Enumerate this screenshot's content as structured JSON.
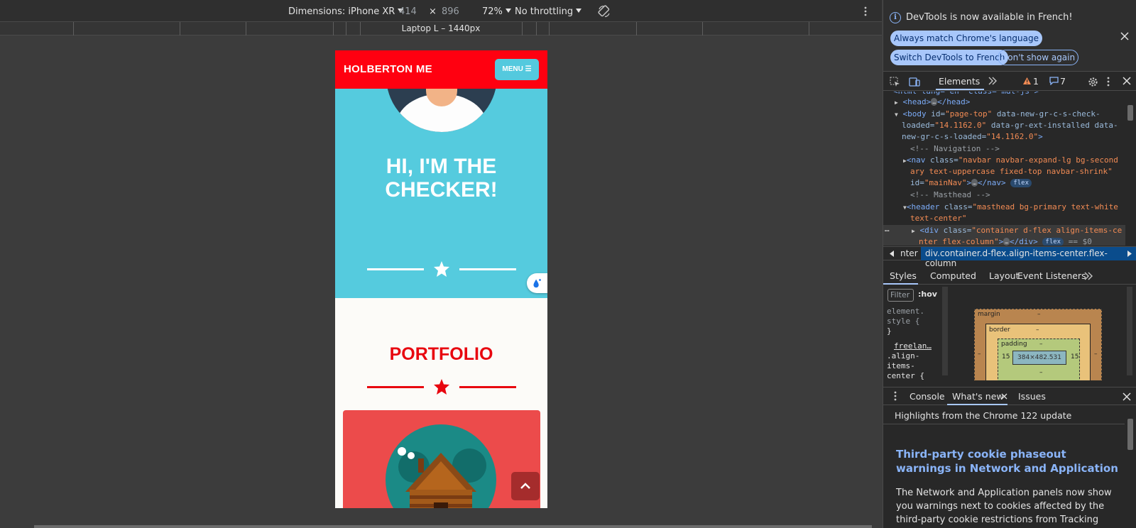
{
  "emulation": {
    "device_label": "Dimensions: iPhone XR",
    "width": "414",
    "times": "×",
    "height": "896",
    "zoom": "72%",
    "throttling": "No throttling",
    "media_query_label": "Laptop L – 1440px"
  },
  "page": {
    "brand": "HOLBERTON ME",
    "menu_label": "MENU ☰",
    "heading": "HI, I'M THE CHECKER!",
    "portfolio_title": "PORTFOLIO",
    "top_button_glyph": "⌃",
    "float_glyph": "💧",
    "colors": {
      "nav": "#ff0010",
      "masthead": "#55cbde",
      "accent_red": "#e8060f",
      "card": "#ec4b4b"
    }
  },
  "devtools": {
    "info_icon": "i",
    "info_text": "DevTools is now available in French!",
    "btn_match": "Always match Chrome's language",
    "btn_switch": "Switch DevTools to French",
    "btn_dont_show": "Don't show again",
    "tab_elements": "Elements",
    "warnings": "1",
    "messages": "7",
    "dom": {
      "l0": "<html lang=\"en\" class=\"mdl-js\">",
      "head_open": "<head>",
      "head_close": "</head>",
      "body_tag": "<body",
      "body_id_attr": " id=",
      "body_id_val": "\"page-top\"",
      "body_attr2": " data-new-gr-c-s-check-",
      "body_attr2b": "loaded=",
      "body_val2": "\"14.1162.0\"",
      "body_attr3": " data-gr-ext-installed",
      "body_attr4": " data-",
      "body_attr4b": "new-gr-c-s-loaded=",
      "body_val4": "\"14.1162.0\"",
      "gt": ">",
      "comment_nav": "<!-- Navigation -->",
      "nav_tag": "<nav",
      "class_attr": " class=",
      "nav_class_a": "\"navbar navbar-expand-lg bg-second",
      "nav_class_b": "ary text-uppercase fixed-top navbar-shrink\"",
      "id_attr": "id=",
      "nav_id": "\"mainNav\"",
      "nav_close": "</nav>",
      "flex_badge": "flex",
      "comment_masthead": "<!-- Masthead -->",
      "header_tag": "<header",
      "header_class_a": "\"masthead bg-primary text-white",
      "header_class_b": "text-center\"",
      "div_tag": "<div",
      "div_class_a": "\"container d-flex align-items-ce",
      "div_class_b": "nter flex-column\"",
      "div_close": "</div>",
      "dollar": "== $0",
      "ellipsis": "…"
    },
    "breadcrumb_prev": "nter",
    "breadcrumb_selected": "div.container.d-flex.align-items-center.flex-column",
    "style_tabs": [
      "Styles",
      "Computed",
      "Layout",
      "Event Listeners"
    ],
    "filter_placeholder": "Filter",
    "hov": ":hov",
    "element_style": [
      "element.",
      "style {",
      "}"
    ],
    "rule_lines": [
      "freelan…",
      ".align-",
      "items-",
      "center {"
    ],
    "box_model": {
      "margin_label": "margin",
      "border_label": "border",
      "padding_label": "padding",
      "content": "384×482.531",
      "dash": "–",
      "padding_side": "15"
    },
    "drawer_tabs": [
      "Console",
      "What's new",
      "Issues"
    ],
    "highlights": "Highlights from the Chrome 122 update",
    "whats_new_title": "Third-party cookie phaseout warnings in Network and Application",
    "whats_new_body": "The Network and Application panels now show you warnings next to cookies affected by the third-party cookie restrictions from Tracking"
  }
}
